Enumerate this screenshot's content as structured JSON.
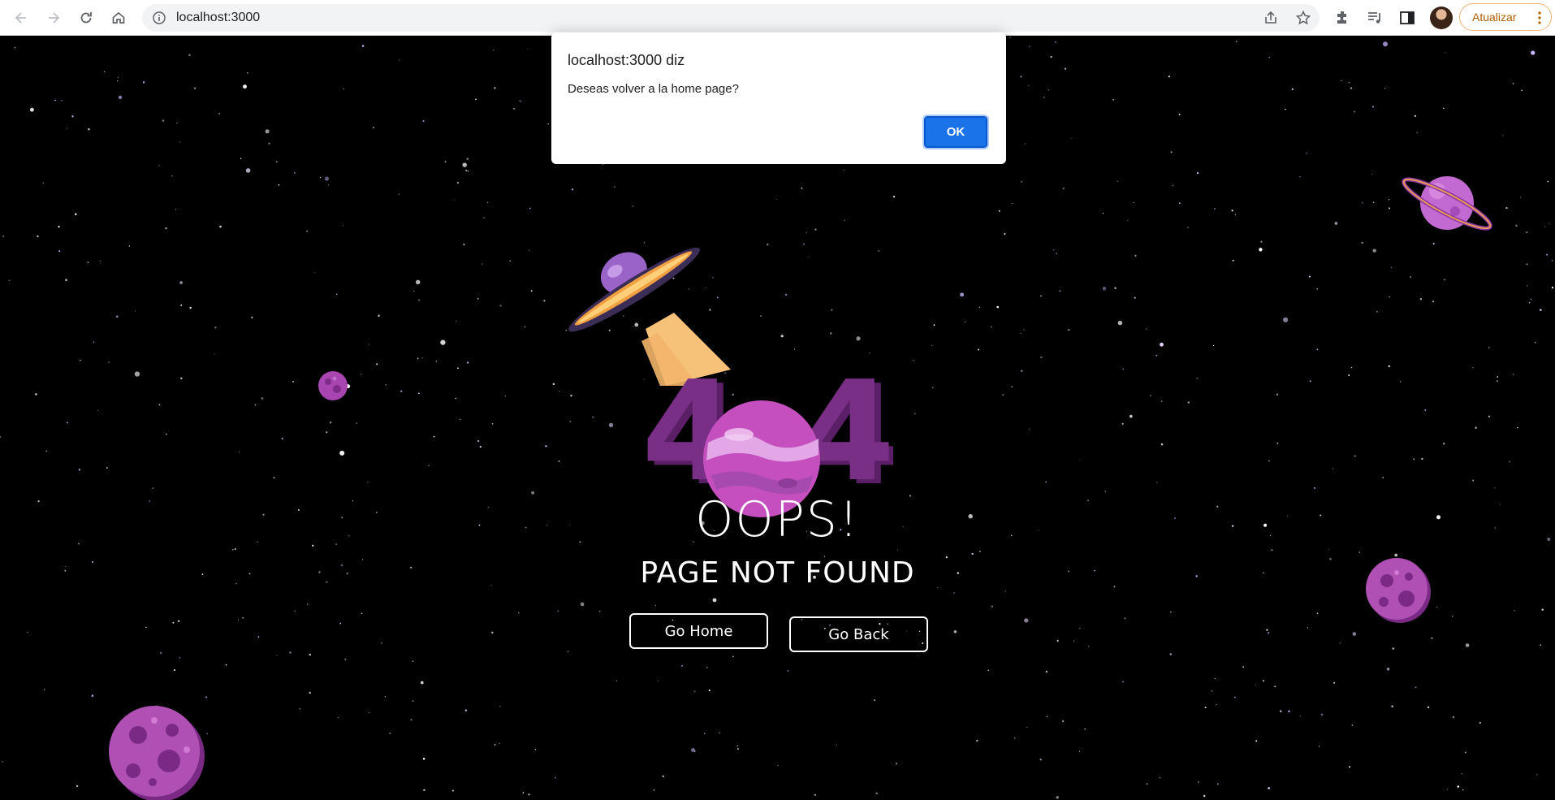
{
  "browser": {
    "url": "localhost:3000",
    "update_label": "Atualizar",
    "icons": [
      "back-arrow-icon",
      "forward-arrow-icon",
      "reload-icon",
      "home-icon",
      "info-icon",
      "share-icon",
      "star-icon",
      "extensions-icon",
      "media-icon",
      "side-panel-icon",
      "menu-dots-icon"
    ],
    "accent_color": "#1a73e8"
  },
  "page": {
    "error_code": "404",
    "headline": "OOPS!",
    "subheadline": "PAGE NOT FOUND",
    "buttons": {
      "home": "Go Home",
      "back": "Go Back"
    },
    "colors": {
      "background": "#000000",
      "purple": "#7a2f87",
      "pink": "#c050c0",
      "orange": "#f5a04a"
    }
  },
  "dialog": {
    "title": "localhost:3000 diz",
    "message": "Deseas volver a la home page?",
    "ok_label": "OK"
  }
}
